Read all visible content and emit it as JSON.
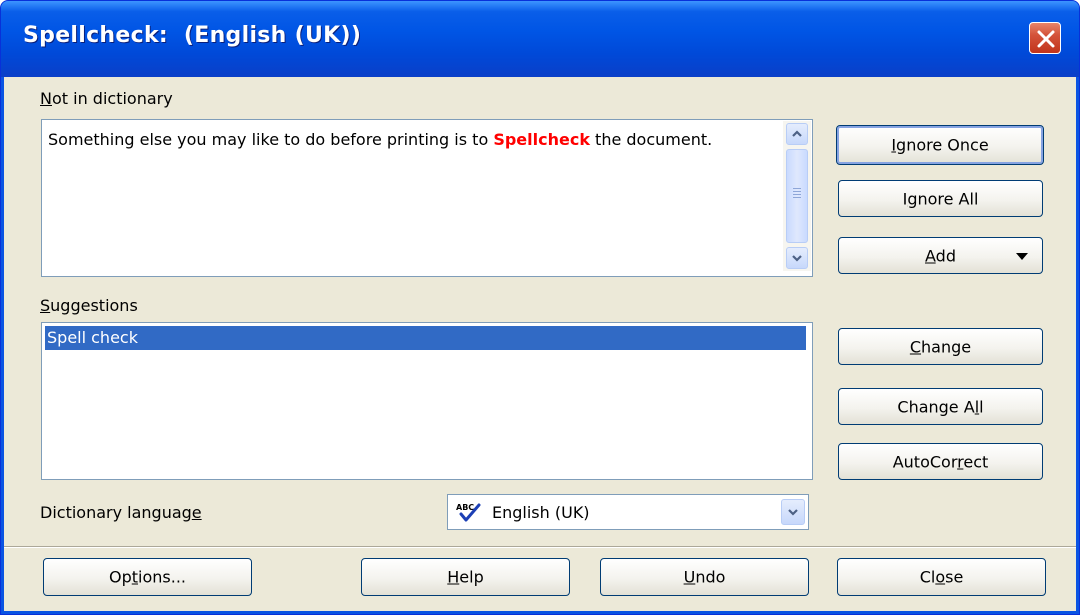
{
  "window": {
    "title": "Spellcheck:  (English (UK))"
  },
  "not_in_dictionary": {
    "label_accel": "N",
    "label_rest": "ot in dictionary",
    "text_before": "Something else you may like to do before printing is to ",
    "error_word": "Spellcheck",
    "text_after": " the document.",
    "error_color": "#ff0000"
  },
  "suggestions": {
    "label_accel": "S",
    "label_rest": "uggestions",
    "items": [
      "Spell check"
    ],
    "selected_index": 0,
    "selection_color": "#316ac5"
  },
  "dictionary_language": {
    "label_before": "Dictionary languag",
    "label_accel": "e",
    "selected_value": "English (UK)",
    "icon": "abc-checkmark-icon"
  },
  "buttons": {
    "ignore_once": {
      "before": "",
      "accel": "I",
      "after": "gnore Once"
    },
    "ignore_all": {
      "before": "I",
      "accel": "g",
      "after": "nore All"
    },
    "add": {
      "before": "",
      "accel": "A",
      "after": "dd"
    },
    "change": {
      "before": "",
      "accel": "C",
      "after": "hange"
    },
    "change_all": {
      "before": "Change A",
      "accel": "l",
      "after": "l"
    },
    "autocorrect": {
      "before": "AutoCor",
      "accel": "r",
      "after": "ect"
    },
    "options": {
      "before": "Op",
      "accel": "t",
      "after": "ions..."
    },
    "help": {
      "before": "",
      "accel": "H",
      "after": "elp"
    },
    "undo": {
      "before": "",
      "accel": "U",
      "after": "ndo"
    },
    "close": {
      "before": "Cl",
      "accel": "o",
      "after": "se"
    }
  },
  "colors": {
    "titlebar": "#0055e5",
    "dialog_face": "#ece9d8",
    "button_border": "#003c74"
  }
}
